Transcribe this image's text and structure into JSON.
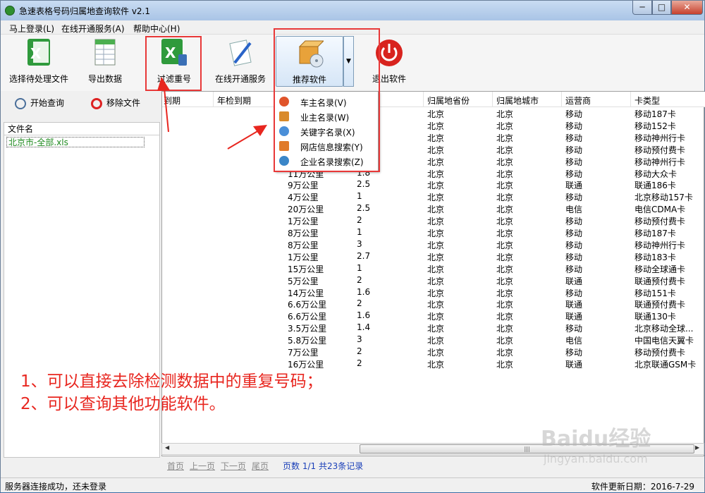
{
  "window": {
    "title": "急速表格号码归属地查询软件 v2.1",
    "minimize": "─",
    "maximize": "□",
    "close": "✕"
  },
  "menu": [
    "马上登录(L)",
    "在线开通服务(A)",
    "帮助中心(H)"
  ],
  "toolbar": {
    "select_file": "选择待处理文件",
    "export": "导出数据",
    "filter_dup": "过滤重号",
    "open_service": "在线开通服务",
    "recommend": "推荐软件",
    "exit": "退出软件"
  },
  "left": {
    "start_query": "开始查询",
    "remove_file": "移除文件",
    "file_header": "文件名",
    "file_name": "北京市-全部.xls"
  },
  "dropdown": [
    "车主名录(V)",
    "业主名录(W)",
    "关键字名录(X)",
    "网店信息搜索(Y)",
    "企业名录搜索(Z)"
  ],
  "columns": [
    "到期",
    "年检到期",
    "",
    "归属地省份",
    "归属地城市",
    "运营商",
    "卡类型"
  ],
  "rows": [
    {
      "a": "",
      "b": "",
      "p": "北京",
      "c": "北京",
      "o": "移动",
      "t": "移动187卡"
    },
    {
      "a": "",
      "b": "",
      "p": "北京",
      "c": "北京",
      "o": "移动",
      "t": "移动152卡"
    },
    {
      "a": "",
      "b": "",
      "p": "北京",
      "c": "北京",
      "o": "移动",
      "t": "移动神州行卡"
    },
    {
      "a": "",
      "b": "",
      "p": "北京",
      "c": "北京",
      "o": "移动",
      "t": "移动预付费卡"
    },
    {
      "a": "",
      "b": "",
      "p": "北京",
      "c": "北京",
      "o": "移动",
      "t": "移动神州行卡"
    },
    {
      "a": "11万公里",
      "b": "1.8",
      "p": "北京",
      "c": "北京",
      "o": "移动",
      "t": "移动大众卡"
    },
    {
      "a": "9万公里",
      "b": "2.5",
      "p": "北京",
      "c": "北京",
      "o": "联通",
      "t": "联通186卡"
    },
    {
      "a": "4万公里",
      "b": "1",
      "p": "北京",
      "c": "北京",
      "o": "移动",
      "t": "北京移动157卡"
    },
    {
      "a": "20万公里",
      "b": "2.5",
      "p": "北京",
      "c": "北京",
      "o": "电信",
      "t": "电信CDMA卡"
    },
    {
      "a": "1万公里",
      "b": "2",
      "p": "北京",
      "c": "北京",
      "o": "移动",
      "t": "移动预付费卡"
    },
    {
      "a": "8万公里",
      "b": "1",
      "p": "北京",
      "c": "北京",
      "o": "移动",
      "t": "移动187卡"
    },
    {
      "a": "8万公里",
      "b": "3",
      "p": "北京",
      "c": "北京",
      "o": "移动",
      "t": "移动神州行卡"
    },
    {
      "a": "1万公里",
      "b": "2.7",
      "p": "北京",
      "c": "北京",
      "o": "移动",
      "t": "移动183卡"
    },
    {
      "a": "15万公里",
      "b": "1",
      "p": "北京",
      "c": "北京",
      "o": "移动",
      "t": "移动全球通卡"
    },
    {
      "a": "5万公里",
      "b": "2",
      "p": "北京",
      "c": "北京",
      "o": "联通",
      "t": "联通预付费卡"
    },
    {
      "a": "14万公里",
      "b": "1.6",
      "p": "北京",
      "c": "北京",
      "o": "移动",
      "t": "移动151卡"
    },
    {
      "a": "6.6万公里",
      "b": "2",
      "p": "北京",
      "c": "北京",
      "o": "联通",
      "t": "联通预付费卡"
    },
    {
      "a": "6.6万公里",
      "b": "1.6",
      "p": "北京",
      "c": "北京",
      "o": "联通",
      "t": "联通130卡"
    },
    {
      "a": "3.5万公里",
      "b": "1.4",
      "p": "北京",
      "c": "北京",
      "o": "移动",
      "t": "北京移动全球..."
    },
    {
      "a": "5.8万公里",
      "b": "3",
      "p": "北京",
      "c": "北京",
      "o": "电信",
      "t": "中国电信天翼卡"
    },
    {
      "a": "7万公里",
      "b": "2",
      "p": "北京",
      "c": "北京",
      "o": "移动",
      "t": "移动预付费卡"
    },
    {
      "a": "16万公里",
      "b": "2",
      "p": "北京",
      "c": "北京",
      "o": "联通",
      "t": "北京联通GSM卡"
    }
  ],
  "pager": {
    "first": "首页",
    "prev": "上一页",
    "next": "下一页",
    "last": "尾页",
    "info": "页数 1/1 共23条记录"
  },
  "status": {
    "left": "服务器连接成功，还未登录",
    "right": "软件更新日期：2016-7-29"
  },
  "annotation": {
    "line1": "1、可以直接去除检测数据中的重复号码；",
    "line2": "2、可以查询其他功能软件。"
  },
  "watermark": {
    "logo": "Baidu经验",
    "url": "jingyan.baidu.com"
  },
  "colors": {
    "annotation": "#e8261f",
    "highlight_box": "#e83838",
    "file_green": "#1f8a1f",
    "pager_info": "#1a3fb8"
  }
}
